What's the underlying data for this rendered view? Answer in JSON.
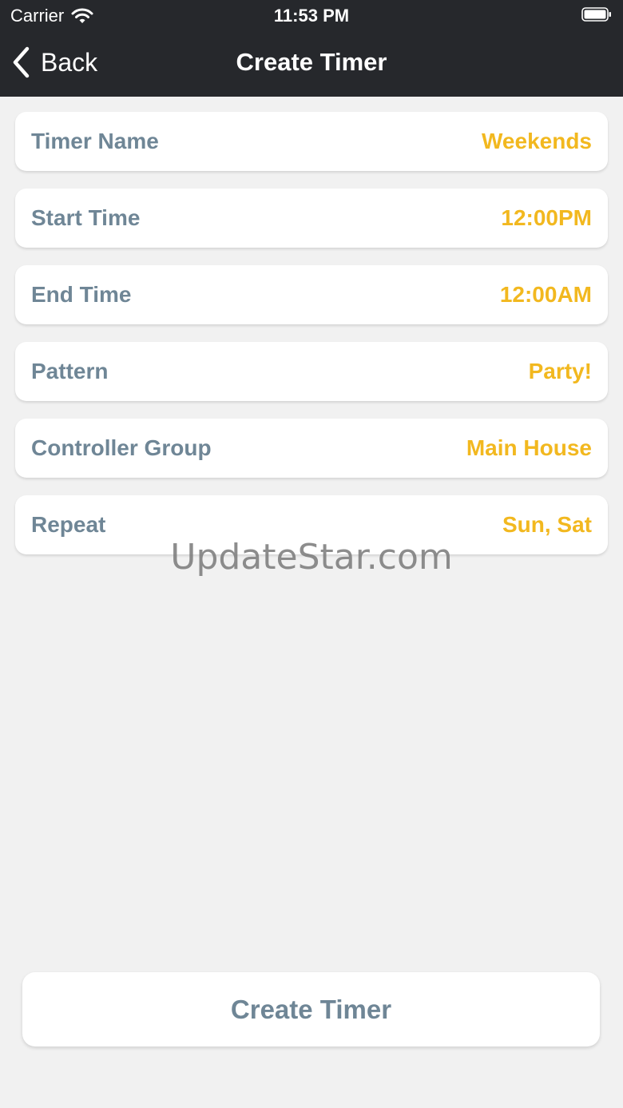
{
  "status_bar": {
    "carrier": "Carrier",
    "time": "11:53 PM",
    "wifi_icon": "wifi-icon",
    "battery_icon": "battery-icon"
  },
  "nav": {
    "back_label": "Back",
    "back_icon": "chevron-left-icon",
    "title": "Create Timer"
  },
  "rows": [
    {
      "label": "Timer Name",
      "value": "Weekends"
    },
    {
      "label": "Start Time",
      "value": "12:00PM"
    },
    {
      "label": "End Time",
      "value": "12:00AM"
    },
    {
      "label": "Pattern",
      "value": "Party!"
    },
    {
      "label": "Controller Group",
      "value": "Main House"
    },
    {
      "label": "Repeat",
      "value": "Sun, Sat"
    }
  ],
  "watermark": "UpdateStar.com",
  "footer": {
    "create_button_label": "Create Timer"
  },
  "colors": {
    "header_bg": "#26282c",
    "page_bg": "#f1f1f1",
    "label": "#6f8696",
    "value_accent": "#f2b81f"
  }
}
